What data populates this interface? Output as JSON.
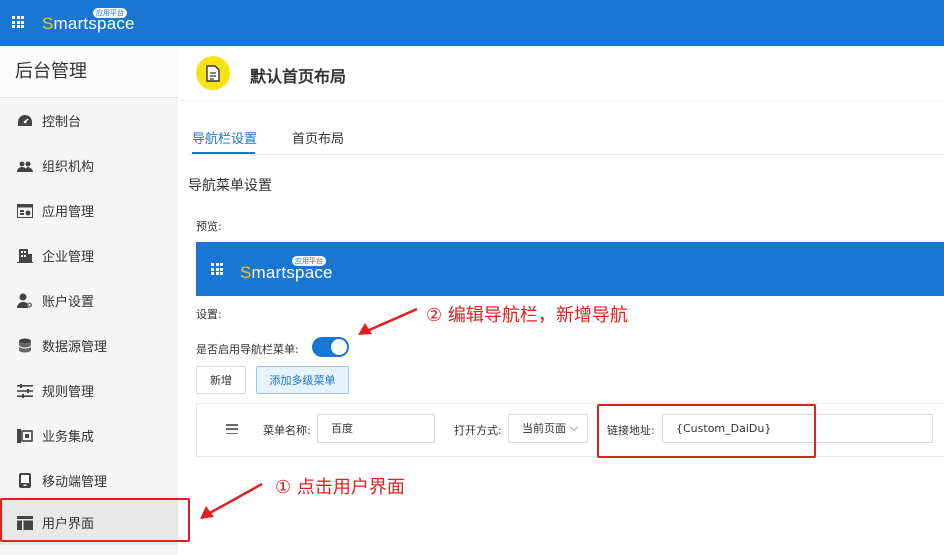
{
  "topbar": {
    "logo_initial": "S",
    "logo_rest": "martspace",
    "logo_badge": "应用平台"
  },
  "sidebar": {
    "title": "后台管理",
    "items": [
      {
        "label": "控制台",
        "icon": "dashboard-icon"
      },
      {
        "label": "组织机构",
        "icon": "users-icon"
      },
      {
        "label": "应用管理",
        "icon": "app-settings-icon"
      },
      {
        "label": "企业管理",
        "icon": "building-icon"
      },
      {
        "label": "账户设置",
        "icon": "user-settings-icon"
      },
      {
        "label": "数据源管理",
        "icon": "database-icon"
      },
      {
        "label": "规则管理",
        "icon": "sliders-icon"
      },
      {
        "label": "业务集成",
        "icon": "integration-icon"
      },
      {
        "label": "移动端管理",
        "icon": "mobile-icon"
      },
      {
        "label": "用户界面",
        "icon": "layout-icon"
      }
    ],
    "active_index": 9
  },
  "header": {
    "title": "默认首页布局",
    "icon": "document-icon",
    "icon_color": "#f5e20f"
  },
  "tabs": [
    {
      "label": "导航栏设置",
      "active": true
    },
    {
      "label": "首页布局",
      "active": false
    }
  ],
  "section": {
    "title": "导航菜单设置",
    "preview_label": "预览:",
    "settings_label": "设置:",
    "switch_label": "是否启用导航栏菜单:",
    "switch_on": true
  },
  "buttons": {
    "add": "新增",
    "add_multilevel": "添加多级菜单"
  },
  "menu_row": {
    "name_label": "菜单名称:",
    "name_value": "百度",
    "open_label": "打开方式:",
    "open_value": "当前页面",
    "link_label": "链接地址:",
    "link_value": "{Custom_DaiDu}"
  },
  "annotations": {
    "step1": "① 点击用户界面",
    "step2": "② 编辑导航栏，新增导航",
    "color": "#e02020"
  },
  "colors": {
    "brand": "#1976d2",
    "logo_accent": "#f5c518",
    "sidebar_bg": "#f5f5f5"
  }
}
